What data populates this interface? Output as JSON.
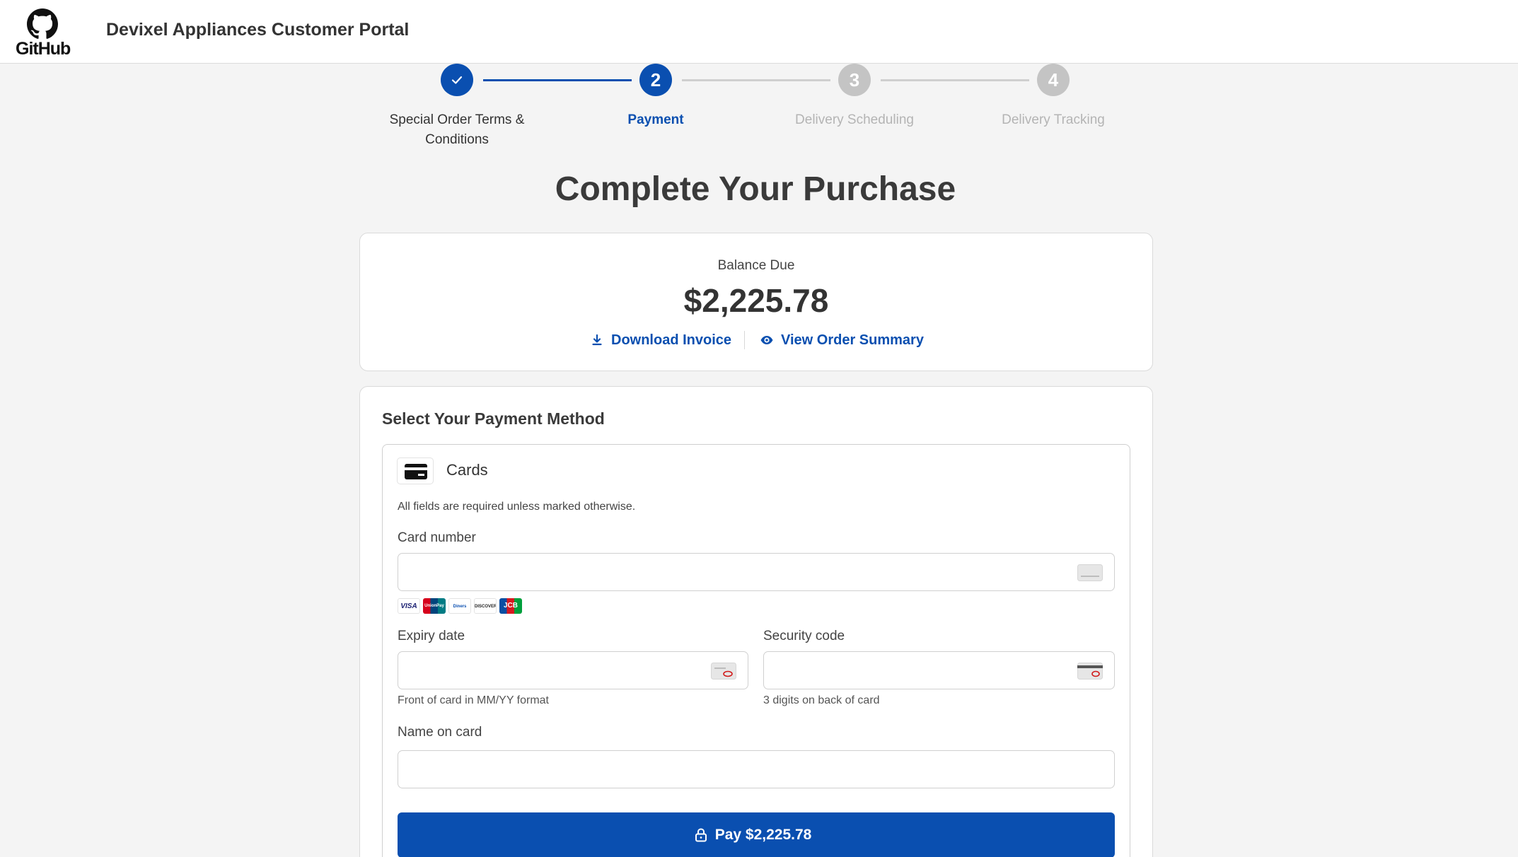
{
  "header": {
    "logo_text": "GitHub",
    "portal_title": "Devixel Appliances Customer Portal"
  },
  "stepper": {
    "steps": [
      {
        "number": "1",
        "label": "Special Order Terms & Conditions",
        "state": "done"
      },
      {
        "number": "2",
        "label": "Payment",
        "state": "current"
      },
      {
        "number": "3",
        "label": "Delivery Scheduling",
        "state": "upcoming"
      },
      {
        "number": "4",
        "label": "Delivery Tracking",
        "state": "upcoming"
      }
    ]
  },
  "page": {
    "title": "Complete Your Purchase"
  },
  "balance": {
    "label": "Balance Due",
    "amount": "$2,225.78",
    "download_invoice": "Download Invoice",
    "view_order_summary": "View Order Summary"
  },
  "payment": {
    "section_title": "Select Your Payment Method",
    "method_name": "Cards",
    "required_note": "All fields are required unless marked otherwise.",
    "card_number_label": "Card number",
    "card_number_value": "",
    "brands": [
      "VISA",
      "UnionPay",
      "Diners",
      "DISCOVER",
      "JCB"
    ],
    "expiry_label": "Expiry date",
    "expiry_value": "",
    "expiry_hint": "Front of card in MM/YY format",
    "security_label": "Security code",
    "security_value": "",
    "security_hint": "3 digits on back of card",
    "name_label": "Name on card",
    "name_value": "",
    "pay_button": "Pay $2,225.78"
  },
  "colors": {
    "accent": "#0a4fb0",
    "inactive_step": "#c4c4c4",
    "background": "#f4f4f4"
  }
}
